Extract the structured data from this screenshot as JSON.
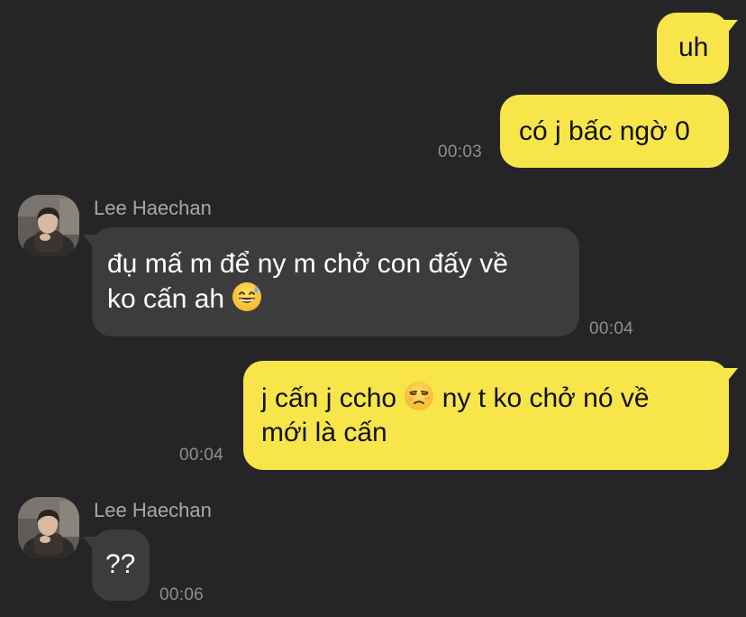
{
  "conversation": {
    "messages": [
      {
        "side": "outgoing",
        "text": "uh"
      },
      {
        "side": "outgoing",
        "text": "có j bấc ngờ 0",
        "time": "00:03"
      },
      {
        "side": "incoming",
        "sender": "Lee Haechan",
        "line1": "đụ mấ m để ny m chở con đấy về",
        "line2_before_emoji": "ko cấn ah",
        "emoji": "grinning-sweat-emoji",
        "time": "00:04"
      },
      {
        "side": "outgoing",
        "line1_before_emoji": "j cấn j ccho",
        "emoji": "unamused-face-emoji",
        "line1_after_emoji": "ny t ko chở nó về",
        "line2": "mới là cấn",
        "time": "00:04"
      },
      {
        "side": "incoming",
        "sender": "Lee Haechan",
        "text": "??",
        "time": "00:06"
      }
    ]
  },
  "theme": {
    "background": "#252527",
    "outgoing_bubble": "#f7e54a",
    "incoming_bubble": "#3c3c3e",
    "timestamp": "#8e8e92",
    "sender_name": "#a8a8ac"
  }
}
